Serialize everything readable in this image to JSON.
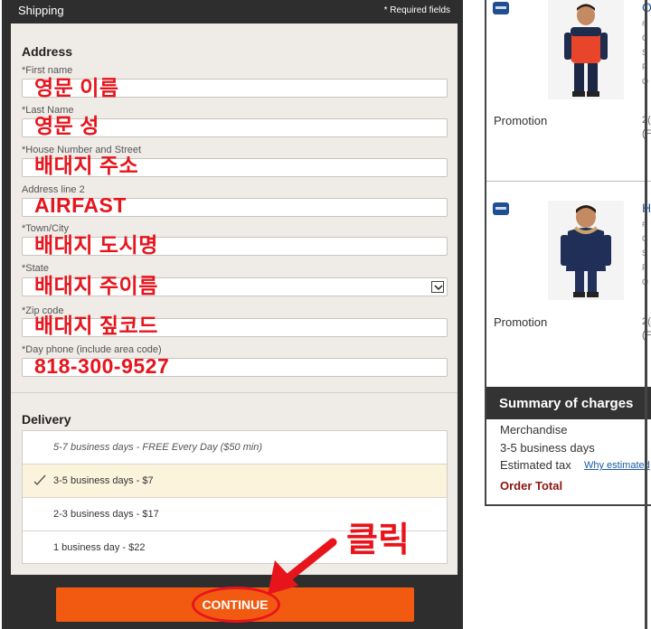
{
  "shipping": {
    "title": "Shipping",
    "required_note": "* Required fields"
  },
  "address": {
    "title": "Address",
    "fields": [
      {
        "label": "*First name",
        "value": "영문 이름"
      },
      {
        "label": "*Last Name",
        "value": "영문 성"
      },
      {
        "label": "*House Number and Street",
        "value": "배대지 주소"
      },
      {
        "label": "Address line 2",
        "value": "AIRFAST"
      },
      {
        "label": "*Town/City",
        "value": "배대지 도시명"
      },
      {
        "label": "*State",
        "value": "배대지 주이름"
      },
      {
        "label": "*Zip code",
        "value": "배대지 짚코드"
      },
      {
        "label": "*Day phone (include area code)",
        "value": "818-300-9527"
      }
    ]
  },
  "delivery": {
    "title": "Delivery",
    "options": [
      {
        "label": "5-7 business days - FREE Every Day ($50 min)",
        "selected": false
      },
      {
        "label": "3-5 business days - $7",
        "selected": true
      },
      {
        "label": "2-3 business days - $17",
        "selected": false
      },
      {
        "label": "1 business day - $22",
        "selected": false
      }
    ]
  },
  "continue_label": "CONTINUE",
  "annotation": {
    "click_text": "클릭",
    "color": "#e8141c"
  },
  "cart": {
    "items": [
      {
        "title": "O",
        "promo_label": "Promotion",
        "promo_value": "2(",
        "promo_value2": "(F"
      },
      {
        "title": "H",
        "promo_label": "Promotion",
        "promo_value": "2(",
        "promo_value2": "(F"
      }
    ],
    "summary": {
      "title": "Summary of charges",
      "merchandise": "Merchandise",
      "shipping": "3-5 business days",
      "tax": "Estimated tax",
      "tax_link": "Why estimated",
      "order_total": "Order Total"
    }
  },
  "colors": {
    "accent": "#f25a12",
    "dark": "#2e2e2e",
    "link": "#1a5aa6",
    "total": "#8b1414"
  }
}
